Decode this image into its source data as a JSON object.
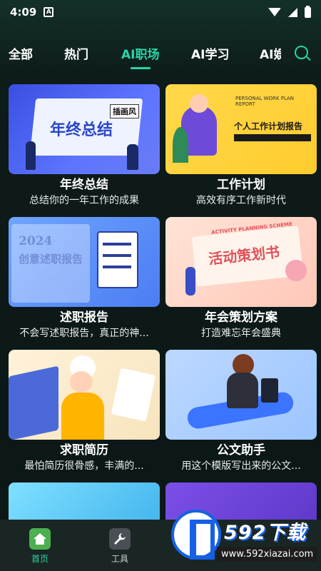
{
  "status_bar": {
    "time": "4:09",
    "notification_icon": "A"
  },
  "tabs": [
    {
      "label": "全部"
    },
    {
      "label": "热门"
    },
    {
      "label": "AI职场",
      "active": true
    },
    {
      "label": "AI学习"
    },
    {
      "label": "AI娱"
    }
  ],
  "cards": [
    {
      "title": "年终总结",
      "subtitle": "总结你的一年工作的成果",
      "thumb_text": "年终总结",
      "thumb_tag": "插画风"
    },
    {
      "title": "工作计划",
      "subtitle": "高效有序工作新时代",
      "thumb_text": "个人工作计划报告",
      "thumb_tag": "PERSONAL WORK PLAN REPORT"
    },
    {
      "title": "述职报告",
      "subtitle": "不会写述职报告，真正的神...",
      "thumb_text": "创意述职报告",
      "thumb_tag": "2024"
    },
    {
      "title": "年会策划方案",
      "subtitle": "打造难忘年会盛典",
      "thumb_text": "活动策划书",
      "thumb_tag": "ACTIVITY PLANNING SCHEME"
    },
    {
      "title": "求职简历",
      "subtitle": "最怕简历很骨感，丰满的...",
      "thumb_text": "",
      "thumb_tag": ""
    },
    {
      "title": "公文助手",
      "subtitle": "用这个模版写出来的公文...",
      "thumb_text": "",
      "thumb_tag": ""
    }
  ],
  "bottom_nav": [
    {
      "label": "首页",
      "icon": "home-icon",
      "active": true
    },
    {
      "label": "工具",
      "icon": "wrench-icon",
      "active": false
    }
  ],
  "watermark": {
    "brand": "592下载",
    "url": "www.592xiazai.com"
  },
  "colors": {
    "accent": "#28d6a7",
    "background": "#0d1b19"
  }
}
